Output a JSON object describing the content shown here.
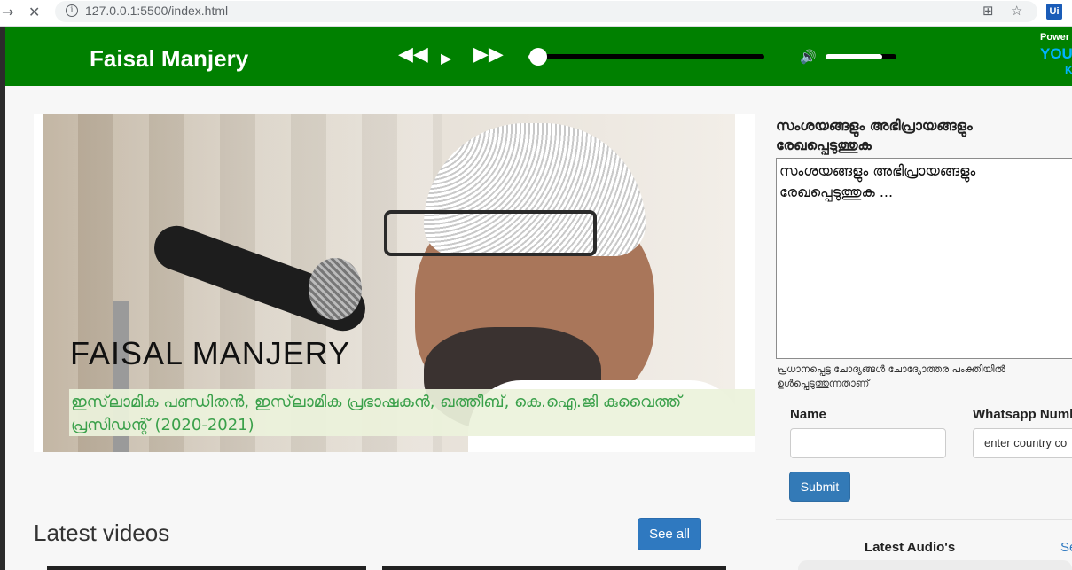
{
  "browser": {
    "url": "127.0.0.1:5500/index.html",
    "back_icon": "arrow-right-icon",
    "stop_icon": "close-icon",
    "ext_label": "Ui"
  },
  "header": {
    "brand": "Faisal Manjery",
    "player": {
      "progress_fraction": 0.04,
      "volume_fraction": 0.8
    },
    "powered_by": "Power",
    "powered_brand": "YOU",
    "powered_k": "K"
  },
  "hero": {
    "title": "FAISAL MANJERY",
    "subtitle": "ഇസ്‌ലാമിക പണ്ഡിതൻ, ഇസ്‌ലാമിക പ്രഭാഷകൻ, ഖത്തീബ്, കെ.ഐ.ജി കുവൈത്ത് പ്രസിഡന്റ് (2020-2021)"
  },
  "videos": {
    "heading": "Latest videos",
    "see_all": "See all"
  },
  "form": {
    "title": "സംശയങ്ങളും അഭിപ്രായങ്ങളും രേഖപ്പെടുത്തുക",
    "textarea_placeholder": "സംശയങ്ങളും അഭിപ്രായങ്ങളും രേഖപ്പെടുത്തുക ...",
    "hint": "പ്രധാനപ്പെട്ട ചോദ്യങ്ങൾ ചോദ്യോത്തര പംക്തിയിൽ ഉൾപ്പെടുത്തുന്നതാണ്",
    "name_label": "Name",
    "whatsapp_label": "Whatsapp Numb",
    "whatsapp_placeholder": "enter country co",
    "submit": "Submit"
  },
  "audio": {
    "heading": "Latest Audio's",
    "see": "Se"
  }
}
